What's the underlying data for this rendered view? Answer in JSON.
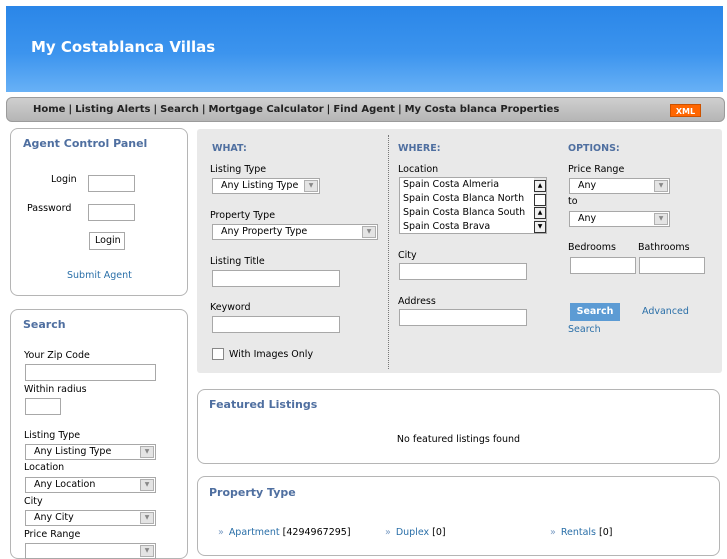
{
  "header": {
    "title": "My Costablanca Villas"
  },
  "nav": {
    "items": [
      "Home",
      "Listing Alerts",
      "Search",
      "Mortgage Calculator",
      "Find Agent",
      "My Costa blanca Properties"
    ],
    "xml_label": "XML"
  },
  "agent_panel": {
    "title": "Agent Control Panel",
    "login_label": "Login",
    "password_label": "Password",
    "login_button": "Login",
    "submit_agent_link": "Submit Agent"
  },
  "side_search": {
    "title": "Search",
    "zip_label": "Your Zip Code",
    "radius_label": "Within radius",
    "listing_type_label": "Listing Type",
    "listing_type_value": "Any Listing Type",
    "location_label": "Location",
    "location_value": "Any Location",
    "city_label": "City",
    "city_value": "Any City",
    "price_range_label": "Price Range"
  },
  "search_form": {
    "what": {
      "title": "WHAT:",
      "listing_type_label": "Listing Type",
      "listing_type_value": "Any Listing Type",
      "property_type_label": "Property Type",
      "property_type_value": "Any Property Type",
      "listing_title_label": "Listing Title",
      "keyword_label": "Keyword",
      "images_only_label": "With Images Only"
    },
    "where": {
      "title": "WHERE:",
      "location_label": "Location",
      "location_options": [
        "Spain Costa Almeria",
        "Spain Costa Blanca North",
        "Spain Costa Blanca South",
        "Spain Costa Brava"
      ],
      "city_label": "City",
      "address_label": "Address"
    },
    "options": {
      "title": "OPTIONS:",
      "price_range_label": "Price Range",
      "price_from": "Any",
      "to_label": "to",
      "price_to": "Any",
      "bedrooms_label": "Bedrooms",
      "bathrooms_label": "Bathrooms",
      "search_button": "Search",
      "advanced_search_link_1": "Advanced",
      "advanced_search_link_2": "Search"
    }
  },
  "featured": {
    "title": "Featured Listings",
    "empty_message": "No featured listings found"
  },
  "property_types": {
    "title": "Property Type",
    "items": [
      {
        "name": "Apartment",
        "count": "[4294967295]"
      },
      {
        "name": "Duplex",
        "count": "[0]"
      },
      {
        "name": "Rentals",
        "count": "[0]"
      }
    ]
  },
  "icons": {
    "scroll_up": "scroll-up-icon",
    "scroll_down": "scroll-down-icon",
    "dropdown": "dropdown-arrow-icon",
    "bullet": "raquo-icon"
  }
}
